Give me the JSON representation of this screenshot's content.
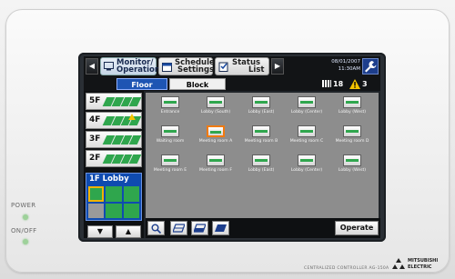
{
  "header": {
    "tabs": [
      {
        "label_line1": "Monitor/",
        "label_line2": "Operation",
        "active": true
      },
      {
        "label_line1": "Schedule",
        "label_line2": "Settings",
        "active": false
      },
      {
        "label_line1": "Status",
        "label_line2": "List",
        "active": false
      }
    ],
    "date": "08/01/2007",
    "time": "11:30AM"
  },
  "view_tabs": {
    "floor": "Floor",
    "block": "Block"
  },
  "counts": {
    "units": "18",
    "warnings": "3"
  },
  "floors": [
    "5F",
    "4F",
    "3F",
    "2F"
  ],
  "selected_block": "1F Lobby",
  "units": [
    {
      "name": "Entrance"
    },
    {
      "name": "Lobby (South)"
    },
    {
      "name": "Lobby (East)"
    },
    {
      "name": "Lobby (Center)"
    },
    {
      "name": "Lobby (West)"
    },
    {
      "name": "Waiting room"
    },
    {
      "name": "Meeting room A",
      "selected": true
    },
    {
      "name": "Meeting room B"
    },
    {
      "name": "Meeting room C"
    },
    {
      "name": "Meeting room D"
    },
    {
      "name": "Meeting room E"
    },
    {
      "name": "Meeting room F"
    },
    {
      "name": "Lobby (East)"
    },
    {
      "name": "Lobby (Center)"
    },
    {
      "name": "Lobby (West)"
    }
  ],
  "bottom": {
    "operate_label": "Operate"
  },
  "hardware": {
    "power_label": "POWER",
    "onoff_label": "ON/OFF",
    "model_label": "CENTRALIZED CONTROLLER AG-150A",
    "brand_line1": "MITSUBISHI",
    "brand_line2": "ELECTRIC"
  }
}
